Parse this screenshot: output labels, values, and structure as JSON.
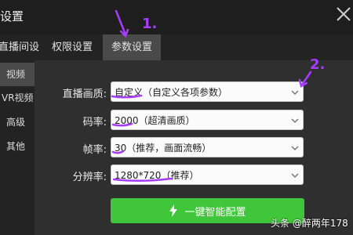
{
  "window": {
    "title": "设置"
  },
  "tabs": [
    {
      "label": "直播间设置"
    },
    {
      "label": "权限设置"
    },
    {
      "label": "参数设置"
    }
  ],
  "sidebar": [
    {
      "label": "视频"
    },
    {
      "label": "VR视频"
    },
    {
      "label": "高级"
    },
    {
      "label": "其他"
    }
  ],
  "fields": [
    {
      "label": "直播画质:",
      "value": "自定义（自定义各项参数）"
    },
    {
      "label": "码率:",
      "value": "2000（超清画质）"
    },
    {
      "label": "帧率:",
      "value": "30（推荐，画面流畅）"
    },
    {
      "label": "分辨率:",
      "value": "1280*720（推荐）"
    }
  ],
  "primary_button": {
    "label": "一键智能配置"
  },
  "annotations": {
    "one": "1.",
    "two": "2."
  },
  "watermark": "头条 @醉两年178",
  "colors": {
    "accent_green": "#40c63a",
    "annotation_purple": "#a63cff",
    "active_tab_bg": "#4a4a4a"
  },
  "icons": {
    "close": "close-icon",
    "chevron": "chevron-down-icon",
    "bolt": "lightning-bolt-icon"
  }
}
